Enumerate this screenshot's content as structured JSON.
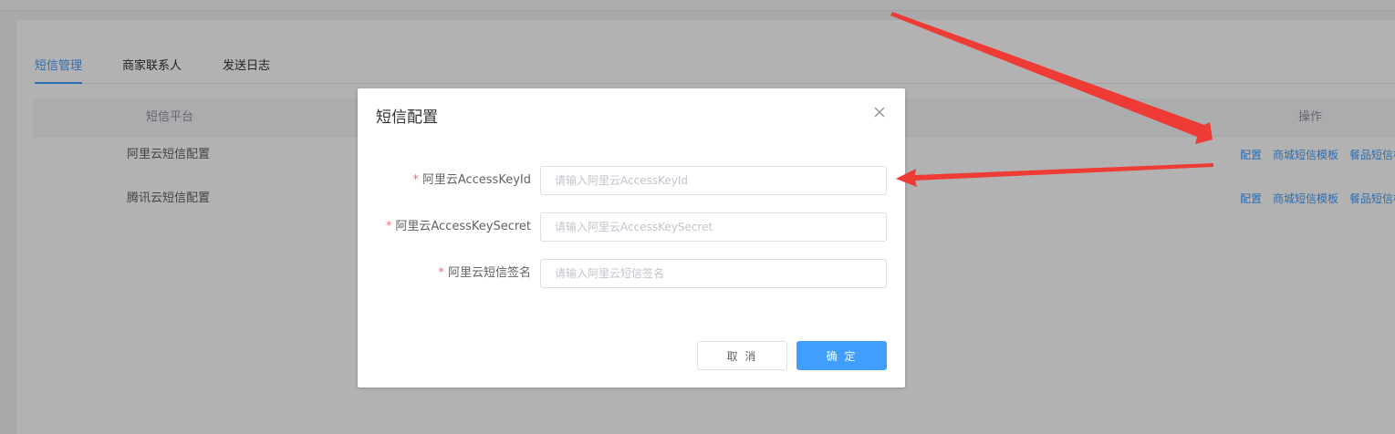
{
  "tabs": [
    {
      "label": "短信管理",
      "active": true
    },
    {
      "label": "商家联系人",
      "active": false
    },
    {
      "label": "发送日志",
      "active": false
    }
  ],
  "table": {
    "headers": {
      "platform": "短信平台",
      "actions": "操作"
    },
    "rows": [
      {
        "platform": "阿里云短信配置",
        "actions": [
          "配置",
          "商城短信模板",
          "餐品短信模板"
        ]
      },
      {
        "platform": "腾讯云短信配置",
        "actions": [
          "配置",
          "商城短信模板",
          "餐品短信模板"
        ]
      }
    ]
  },
  "dialog": {
    "title": "短信配置",
    "close_icon": "close-icon",
    "fields": [
      {
        "required": "*",
        "label": "阿里云AccessKeyId",
        "value": "",
        "placeholder": "请输入阿里云AccessKeyId"
      },
      {
        "required": "*",
        "label": "阿里云AccessKeySecret",
        "value": "",
        "placeholder": "请输入阿里云AccessKeySecret"
      },
      {
        "required": "*",
        "label": "阿里云短信签名",
        "value": "",
        "placeholder": "请输入阿里云短信签名"
      }
    ],
    "cancel_label": "取 消",
    "confirm_label": "确 定"
  },
  "colors": {
    "accent": "#409eff",
    "required": "#f56c6c",
    "annotation_arrow": "#ee3b35"
  }
}
